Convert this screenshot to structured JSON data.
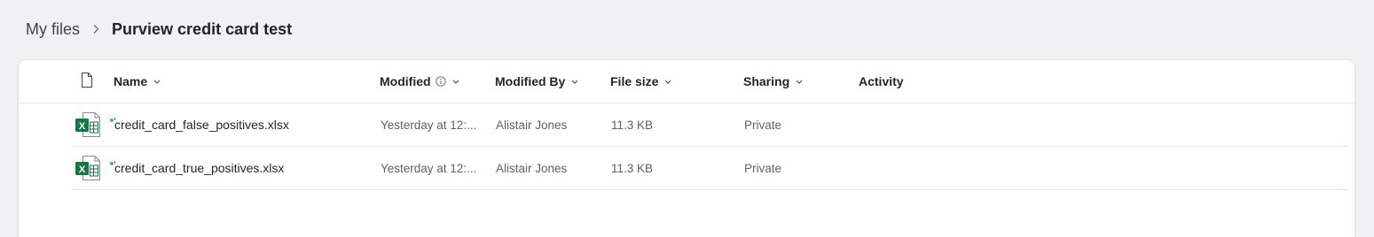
{
  "breadcrumb": {
    "root": "My files",
    "current": "Purview credit card test"
  },
  "columns": {
    "name": "Name",
    "modified": "Modified",
    "modified_by": "Modified By",
    "file_size": "File size",
    "sharing": "Sharing",
    "activity": "Activity"
  },
  "files": [
    {
      "name": "credit_card_false_positives.xlsx",
      "modified": "Yesterday at 12:...",
      "modified_by": "Alistair Jones",
      "file_size": "11.3 KB",
      "sharing": "Private",
      "icon": "excel-file-icon"
    },
    {
      "name": "credit_card_true_positives.xlsx",
      "modified": "Yesterday at 12:...",
      "modified_by": "Alistair Jones",
      "file_size": "11.3 KB",
      "sharing": "Private",
      "icon": "excel-file-icon"
    }
  ],
  "colors": {
    "excel_green": "#107c41",
    "sync_blue": "#0f6cbd",
    "background": "#f1f1f3"
  }
}
